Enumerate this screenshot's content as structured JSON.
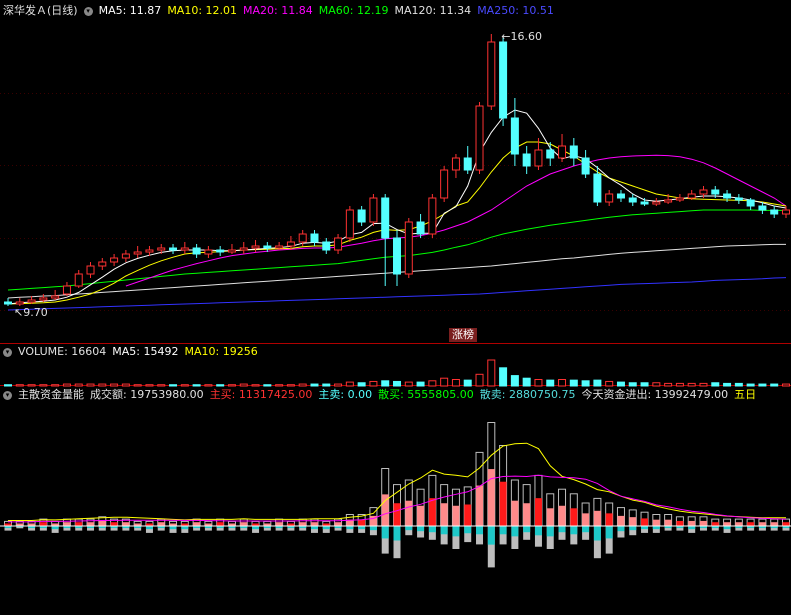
{
  "header_main": {
    "title": "深华发Ａ(日线)",
    "ma5": "MA5: 11.87",
    "ma10": "MA10: 12.01",
    "ma20": "MA20: 11.84",
    "ma60": "MA60: 12.19",
    "ma120": "MA120: 11.34",
    "ma250": "MA250: 10.51"
  },
  "header_volume": {
    "volume": "VOLUME: 16604",
    "ma5": "MA5: 15492",
    "ma10": "MA10: 19256"
  },
  "header_capital": {
    "name": "主散资金量能",
    "turnover": "成交额: 19753980.00",
    "main_buy": "主买: 11317425.00",
    "main_sell": "主卖: 0.00",
    "retail_buy": "散买: 5555805.00",
    "retail_sell": "散卖: 2880750.75",
    "net_flow": "今天资金进出: 13992479.00",
    "five_day": "五日"
  },
  "price_labels": {
    "high": "16.60",
    "low": "9.70"
  },
  "limit_up_tag": "涨榜",
  "colors": {
    "up": "#ff3232",
    "down": "#54ffff",
    "ma5": "#ffffff",
    "ma10": "#ffff00",
    "ma20": "#ff00ff",
    "ma60": "#00ff00",
    "ma120": "#e0e0e0",
    "ma250": "#3232ff",
    "divider": "#b00000"
  },
  "chart_data": {
    "type": "candlestick",
    "y_range": [
      9.2,
      17.0
    ],
    "candles": [
      [
        9.9,
        9.85,
        10.0,
        9.8
      ],
      [
        9.85,
        9.9,
        10.0,
        9.8
      ],
      [
        9.9,
        9.95,
        10.05,
        9.85
      ],
      [
        9.95,
        10.0,
        10.1,
        9.9
      ],
      [
        10.0,
        10.05,
        10.2,
        9.95
      ],
      [
        10.1,
        10.3,
        10.4,
        10.05
      ],
      [
        10.3,
        10.6,
        10.7,
        10.25
      ],
      [
        10.6,
        10.8,
        10.9,
        10.5
      ],
      [
        10.8,
        10.9,
        11.0,
        10.7
      ],
      [
        10.9,
        11.0,
        11.1,
        10.8
      ],
      [
        11.0,
        11.1,
        11.2,
        10.9
      ],
      [
        11.1,
        11.15,
        11.3,
        11.0
      ],
      [
        11.15,
        11.2,
        11.3,
        11.05
      ],
      [
        11.2,
        11.25,
        11.35,
        11.1
      ],
      [
        11.25,
        11.2,
        11.35,
        11.1
      ],
      [
        11.2,
        11.25,
        11.4,
        11.1
      ],
      [
        11.25,
        11.1,
        11.35,
        11.0
      ],
      [
        11.1,
        11.2,
        11.3,
        11.0
      ],
      [
        11.2,
        11.15,
        11.3,
        11.05
      ],
      [
        11.15,
        11.2,
        11.35,
        11.1
      ],
      [
        11.2,
        11.25,
        11.4,
        11.1
      ],
      [
        11.25,
        11.3,
        11.45,
        11.15
      ],
      [
        11.3,
        11.25,
        11.4,
        11.15
      ],
      [
        11.25,
        11.3,
        11.4,
        11.2
      ],
      [
        11.3,
        11.4,
        11.55,
        11.2
      ],
      [
        11.4,
        11.6,
        11.7,
        11.3
      ],
      [
        11.6,
        11.4,
        11.7,
        11.3
      ],
      [
        11.4,
        11.2,
        11.5,
        11.1
      ],
      [
        11.2,
        11.5,
        11.6,
        11.1
      ],
      [
        11.5,
        12.2,
        12.3,
        11.4
      ],
      [
        12.2,
        11.9,
        12.3,
        11.8
      ],
      [
        11.9,
        12.5,
        12.6,
        11.8
      ],
      [
        12.5,
        11.5,
        12.6,
        10.3
      ],
      [
        11.5,
        10.6,
        11.7,
        10.3
      ],
      [
        10.6,
        11.9,
        12.0,
        10.5
      ],
      [
        11.9,
        11.6,
        12.1,
        11.5
      ],
      [
        11.6,
        12.5,
        12.6,
        11.5
      ],
      [
        12.5,
        13.2,
        13.3,
        12.4
      ],
      [
        13.2,
        13.5,
        13.6,
        13.0
      ],
      [
        13.5,
        13.2,
        13.8,
        13.1
      ],
      [
        13.2,
        14.8,
        14.9,
        13.1
      ],
      [
        14.8,
        16.4,
        16.6,
        14.7
      ],
      [
        16.4,
        14.5,
        16.5,
        14.3
      ],
      [
        14.5,
        13.6,
        15.0,
        13.3
      ],
      [
        13.6,
        13.3,
        13.8,
        13.1
      ],
      [
        13.3,
        13.7,
        14.0,
        13.2
      ],
      [
        13.7,
        13.5,
        13.9,
        13.3
      ],
      [
        13.5,
        13.8,
        14.1,
        13.4
      ],
      [
        13.8,
        13.5,
        14.0,
        13.3
      ],
      [
        13.5,
        13.1,
        13.7,
        13.0
      ],
      [
        13.1,
        12.4,
        13.3,
        12.3
      ],
      [
        12.4,
        12.6,
        12.7,
        12.3
      ],
      [
        12.6,
        12.5,
        12.7,
        12.4
      ],
      [
        12.5,
        12.4,
        12.6,
        12.3
      ],
      [
        12.4,
        12.35,
        12.5,
        12.3
      ],
      [
        12.35,
        12.4,
        12.5,
        12.3
      ],
      [
        12.4,
        12.45,
        12.6,
        12.35
      ],
      [
        12.45,
        12.5,
        12.6,
        12.4
      ],
      [
        12.5,
        12.6,
        12.7,
        12.45
      ],
      [
        12.6,
        12.7,
        12.8,
        12.5
      ],
      [
        12.7,
        12.6,
        12.8,
        12.5
      ],
      [
        12.6,
        12.5,
        12.7,
        12.4
      ],
      [
        12.5,
        12.45,
        12.6,
        12.35
      ],
      [
        12.45,
        12.3,
        12.5,
        12.2
      ],
      [
        12.3,
        12.2,
        12.4,
        12.1
      ],
      [
        12.2,
        12.1,
        12.3,
        12.0
      ],
      [
        12.1,
        12.2,
        12.3,
        12.0
      ]
    ],
    "ma5": [
      9.85,
      9.88,
      9.9,
      9.92,
      9.95,
      10.02,
      10.14,
      10.33,
      10.52,
      10.72,
      10.88,
      10.99,
      11.07,
      11.14,
      11.18,
      11.2,
      11.2,
      11.2,
      11.18,
      11.18,
      11.2,
      11.22,
      11.24,
      11.26,
      11.29,
      11.37,
      11.39,
      11.37,
      11.42,
      11.58,
      11.64,
      11.86,
      11.87,
      11.71,
      11.6,
      11.62,
      11.62,
      12.12,
      12.28,
      12.8,
      13.64,
      14.14,
      14.52,
      14.7,
      14.62,
      14.24,
      13.75,
      13.48,
      13.56,
      13.48,
      13.26,
      13.0,
      12.82,
      12.6,
      12.45,
      12.42,
      12.45,
      12.48,
      12.52,
      12.55,
      12.55,
      12.53,
      12.5,
      12.45,
      12.38,
      12.3,
      12.25
    ],
    "ma10": [
      9.85,
      9.86,
      9.87,
      9.88,
      9.9,
      9.95,
      10.02,
      10.1,
      10.22,
      10.37,
      10.55,
      10.69,
      10.82,
      10.93,
      11.02,
      11.1,
      11.13,
      11.14,
      11.16,
      11.18,
      11.2,
      11.21,
      11.22,
      11.23,
      11.24,
      11.28,
      11.3,
      11.3,
      11.33,
      11.44,
      11.52,
      11.64,
      11.71,
      11.69,
      11.71,
      11.8,
      11.93,
      12.1,
      12.3,
      12.4,
      12.75,
      13.15,
      13.5,
      13.75,
      13.9,
      13.9,
      13.85,
      13.7,
      13.55,
      13.35,
      13.15,
      13.0,
      12.9,
      12.8,
      12.7,
      12.6,
      12.55,
      12.5,
      12.48,
      12.47,
      12.46,
      12.45,
      12.44,
      12.43,
      12.4,
      12.35,
      12.3
    ],
    "ma20": [
      null,
      null,
      null,
      null,
      null,
      null,
      null,
      null,
      null,
      null,
      10.3,
      10.4,
      10.5,
      10.6,
      10.7,
      10.78,
      10.86,
      10.93,
      11.0,
      11.06,
      11.1,
      11.14,
      11.17,
      11.2,
      11.22,
      11.24,
      11.25,
      11.25,
      11.27,
      11.32,
      11.37,
      11.43,
      11.48,
      11.5,
      11.52,
      11.56,
      11.62,
      11.7,
      11.8,
      11.9,
      12.05,
      12.2,
      12.4,
      12.6,
      12.8,
      12.95,
      13.1,
      13.2,
      13.3,
      13.38,
      13.45,
      13.5,
      13.53,
      13.55,
      13.56,
      13.57,
      13.56,
      13.53,
      13.47,
      13.38,
      13.25,
      13.1,
      12.95,
      12.8,
      12.65,
      12.5,
      12.3
    ],
    "ma60": [
      10.2,
      10.22,
      10.24,
      10.26,
      10.28,
      10.3,
      10.33,
      10.36,
      10.39,
      10.42,
      10.45,
      10.48,
      10.51,
      10.54,
      10.57,
      10.6,
      10.62,
      10.64,
      10.66,
      10.68,
      10.7,
      10.72,
      10.74,
      10.76,
      10.78,
      10.8,
      10.82,
      10.84,
      10.86,
      10.9,
      10.94,
      10.98,
      11.02,
      11.04,
      11.06,
      11.1,
      11.14,
      11.2,
      11.27,
      11.33,
      11.42,
      11.52,
      11.6,
      11.66,
      11.72,
      11.77,
      11.82,
      11.86,
      11.9,
      11.94,
      11.98,
      12.02,
      12.05,
      12.08,
      12.1,
      12.12,
      12.14,
      12.16,
      12.18,
      12.2,
      12.2,
      12.2,
      12.2,
      12.2,
      12.19,
      12.19,
      12.19
    ],
    "ma120": [
      10.0,
      10.02,
      10.03,
      10.05,
      10.06,
      10.08,
      10.1,
      10.12,
      10.14,
      10.16,
      10.18,
      10.2,
      10.22,
      10.24,
      10.26,
      10.28,
      10.3,
      10.32,
      10.34,
      10.36,
      10.38,
      10.4,
      10.42,
      10.44,
      10.46,
      10.48,
      10.5,
      10.52,
      10.54,
      10.56,
      10.58,
      10.6,
      10.62,
      10.64,
      10.66,
      10.68,
      10.7,
      10.72,
      10.74,
      10.76,
      10.78,
      10.8,
      10.83,
      10.86,
      10.89,
      10.92,
      10.95,
      10.98,
      11.0,
      11.03,
      11.06,
      11.09,
      11.12,
      11.14,
      11.16,
      11.18,
      11.2,
      11.22,
      11.24,
      11.26,
      11.28,
      11.3,
      11.31,
      11.32,
      11.33,
      11.34,
      11.34
    ],
    "ma250": [
      9.7,
      9.71,
      9.72,
      9.73,
      9.74,
      9.75,
      9.76,
      9.77,
      9.78,
      9.79,
      9.8,
      9.81,
      9.82,
      9.83,
      9.84,
      9.85,
      9.86,
      9.87,
      9.88,
      9.89,
      9.9,
      9.91,
      9.92,
      9.93,
      9.94,
      9.95,
      9.96,
      9.97,
      9.98,
      9.99,
      10.0,
      10.01,
      10.02,
      10.03,
      10.04,
      10.05,
      10.06,
      10.07,
      10.08,
      10.09,
      10.1,
      10.12,
      10.14,
      10.16,
      10.18,
      10.2,
      10.22,
      10.24,
      10.26,
      10.28,
      10.3,
      10.32,
      10.34,
      10.35,
      10.36,
      10.37,
      10.38,
      10.39,
      10.4,
      10.42,
      10.44,
      10.45,
      10.46,
      10.47,
      10.48,
      10.5,
      10.51
    ],
    "volume": [
      2,
      2,
      2,
      2,
      2,
      3,
      3,
      3,
      3,
      3,
      3,
      2,
      2,
      2,
      2,
      2,
      2,
      2,
      2,
      2,
      3,
      2,
      2,
      2,
      2,
      3,
      3,
      3,
      3,
      6,
      5,
      7,
      8,
      7,
      6,
      6,
      8,
      12,
      10,
      9,
      18,
      40,
      28,
      16,
      12,
      10,
      9,
      10,
      9,
      8,
      9,
      7,
      6,
      5,
      5,
      5,
      4,
      4,
      4,
      4,
      5,
      4,
      4,
      3,
      3,
      3,
      3
    ],
    "flow": [
      [
        2,
        -2
      ],
      [
        2,
        -1
      ],
      [
        2,
        -2
      ],
      [
        3,
        -2
      ],
      [
        2,
        -3
      ],
      [
        3,
        -2
      ],
      [
        3,
        -2
      ],
      [
        3,
        -2
      ],
      [
        4,
        -2
      ],
      [
        3,
        -2
      ],
      [
        3,
        -2
      ],
      [
        2,
        -2
      ],
      [
        2,
        -3
      ],
      [
        3,
        -2
      ],
      [
        2,
        -3
      ],
      [
        2,
        -3
      ],
      [
        3,
        -2
      ],
      [
        2,
        -2
      ],
      [
        3,
        -2
      ],
      [
        2,
        -2
      ],
      [
        3,
        -2
      ],
      [
        2,
        -3
      ],
      [
        2,
        -2
      ],
      [
        3,
        -2
      ],
      [
        2,
        -2
      ],
      [
        3,
        -2
      ],
      [
        3,
        -3
      ],
      [
        2,
        -3
      ],
      [
        3,
        -2
      ],
      [
        5,
        -3
      ],
      [
        5,
        -3
      ],
      [
        8,
        -4
      ],
      [
        25,
        -12
      ],
      [
        18,
        -14
      ],
      [
        20,
        -4
      ],
      [
        16,
        -5
      ],
      [
        22,
        -6
      ],
      [
        18,
        -8
      ],
      [
        16,
        -10
      ],
      [
        17,
        -7
      ],
      [
        32,
        -8
      ],
      [
        45,
        -18
      ],
      [
        35,
        -8
      ],
      [
        20,
        -10
      ],
      [
        18,
        -6
      ],
      [
        22,
        -9
      ],
      [
        14,
        -10
      ],
      [
        16,
        -6
      ],
      [
        14,
        -8
      ],
      [
        10,
        -6
      ],
      [
        12,
        -14
      ],
      [
        10,
        -12
      ],
      [
        8,
        -5
      ],
      [
        7,
        -4
      ],
      [
        6,
        -3
      ],
      [
        5,
        -3
      ],
      [
        5,
        -2
      ],
      [
        4,
        -2
      ],
      [
        4,
        -3
      ],
      [
        4,
        -2
      ],
      [
        3,
        -2
      ],
      [
        3,
        -3
      ],
      [
        3,
        -2
      ],
      [
        3,
        -2
      ],
      [
        3,
        -2
      ],
      [
        3,
        -2
      ],
      [
        3,
        -2
      ]
    ]
  }
}
